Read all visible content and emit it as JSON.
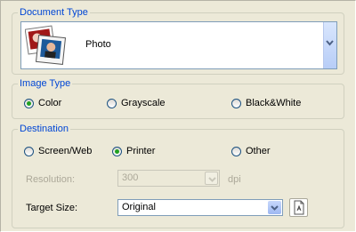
{
  "document_type": {
    "legend": "Document Type",
    "selected": "Photo",
    "thumbnail_icon": "photo-thumbnail-icon",
    "dropdown_icon": "chevron-down-icon"
  },
  "image_type": {
    "legend": "Image Type",
    "options": [
      "Color",
      "Grayscale",
      "Black&White"
    ],
    "selected": "Color"
  },
  "destination": {
    "legend": "Destination",
    "options": [
      "Screen/Web",
      "Printer",
      "Other"
    ],
    "selected": "Printer",
    "resolution_label": "Resolution:",
    "resolution_value": "300",
    "resolution_unit": "dpi",
    "target_size_label": "Target Size:",
    "target_size_value": "Original",
    "target_size_icon": "document-size-icon"
  },
  "colors": {
    "accent": "#0046d5",
    "radio_selected": "#21a121",
    "background": "#ece9d8"
  }
}
